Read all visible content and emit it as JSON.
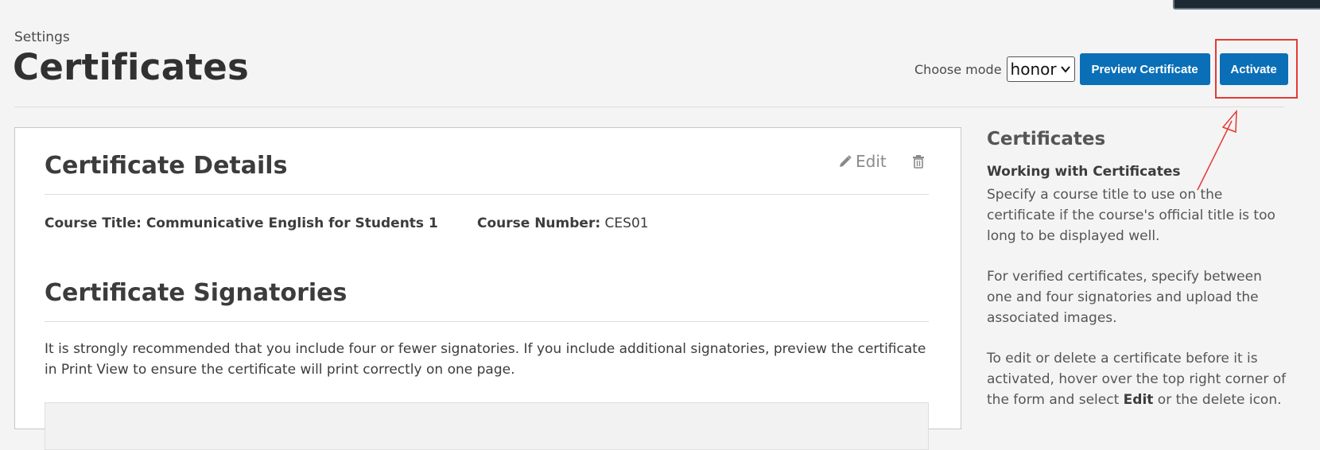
{
  "header": {
    "breadcrumb": "Settings",
    "title": "Certificates",
    "mode_label": "Choose mode",
    "mode_selected": "honor",
    "preview_button": "Preview Certificate",
    "activate_button": "Activate"
  },
  "certificate_details": {
    "title": "Certificate Details",
    "edit_label": "Edit",
    "course_title": "Course Title: Communicative English for Students 1",
    "course_number_label": "Course Number:",
    "course_number_value": " CES01"
  },
  "signatories": {
    "title": "Certificate Signatories",
    "text": "It is strongly recommended that you include four or fewer signatories. If you include additional signatories, preview the certificate in Print View to ensure the certificate will print correctly on one page."
  },
  "sidebar": {
    "title": "Certificates",
    "subtitle": "Working with Certificates",
    "para1": "Specify a course title to use on the certificate if the course's official title is too long to be displayed well.",
    "para2": "For verified certificates, specify between one and four signatories and upload the associated images.",
    "para3_pre": "To edit or delete a certificate before it is activated, hover over the top right corner of the form and select ",
    "para3_bold": "Edit",
    "para3_post": " or the delete icon."
  },
  "colors": {
    "primary_button": "#0a6fb7",
    "annotation": "#e53935"
  },
  "icons": [
    "pencil-icon",
    "trash-icon",
    "chevron-down-icon"
  ]
}
